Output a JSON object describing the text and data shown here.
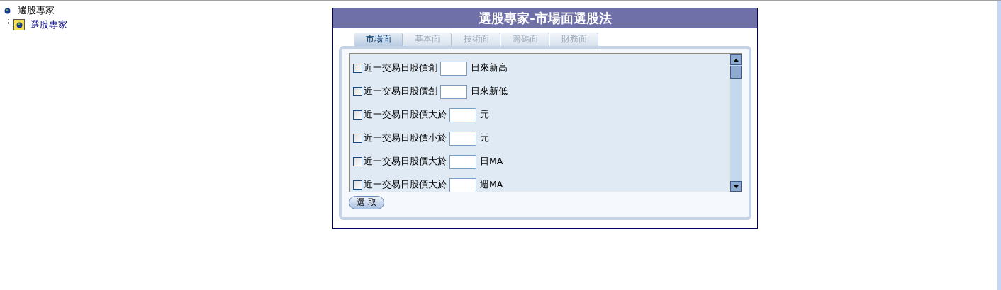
{
  "tree": {
    "label": "選股專家",
    "children": [
      {
        "label": "選股專家"
      }
    ]
  },
  "panel": {
    "title": "選股專家-市場面選股法",
    "tabs": [
      {
        "label": "市場面",
        "selected": true
      },
      {
        "label": "基本面",
        "selected": false
      },
      {
        "label": "技術面",
        "selected": false
      },
      {
        "label": "籌碼面",
        "selected": false
      },
      {
        "label": "財務面",
        "selected": false
      }
    ],
    "criteria": [
      {
        "checked": false,
        "label": "近一交易日股價創",
        "unit": "日來新高"
      },
      {
        "checked": false,
        "label": "近一交易日股價創",
        "unit": "日來新低"
      },
      {
        "checked": false,
        "label": "近一交易日股價大於",
        "unit": "元"
      },
      {
        "checked": false,
        "label": "近一交易日股價小於",
        "unit": "元"
      },
      {
        "checked": false,
        "label": "近一交易日股價大於",
        "unit": "日MA"
      },
      {
        "checked": false,
        "label": "近一交易日股價大於",
        "unit": "週MA"
      }
    ],
    "button": "選 取"
  }
}
